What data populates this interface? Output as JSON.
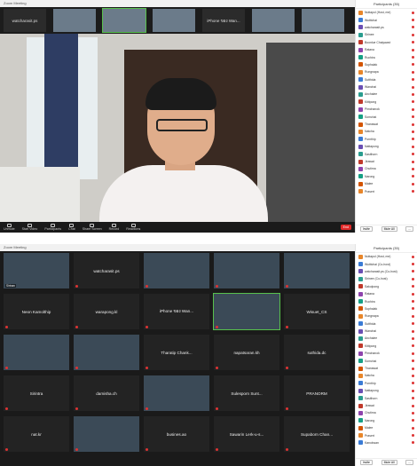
{
  "window1": {
    "title": "Zoom Meeting",
    "thumbs": [
      "watcharasit.ps",
      "",
      "",
      "",
      "iPhone ของ Wan...",
      "",
      ""
    ],
    "toolbar": [
      "Unmute",
      "Start Video",
      "Participants",
      "Chat",
      "Share Screen",
      "Record",
      "Reactions"
    ],
    "end_label": "End",
    "panel_title": "Participants (35)",
    "participants": [
      "Nuttapol (Host, me)",
      "Wuttichai",
      "watcharasit.ps",
      "Sirinee",
      "Boonlue Chaiyawut",
      "Ratana",
      "Ruchira",
      "Suphalak",
      "Rungnapa",
      "Sutthida",
      "Wanchai",
      "Anchalee",
      "Kittipong",
      "Pimchanok",
      "Somchai",
      "Thanawat",
      "Natcha",
      "Pornthip",
      "Nattapong",
      "Sasithorn",
      "Jirawat",
      "Chutima",
      "Narong",
      "Malee",
      "Prasert"
    ],
    "footer": [
      "Invite",
      "Mute All",
      "..."
    ]
  },
  "window2": {
    "title": "Zoom Meeting",
    "cells": [
      {
        "label": "",
        "name": "Sirinan",
        "video": true
      },
      {
        "label": "watcharasit.ps",
        "name": "",
        "video": false
      },
      {
        "label": "",
        "name": "",
        "video": true
      },
      {
        "label": "",
        "name": "",
        "video": true
      },
      {
        "label": "",
        "name": "",
        "video": true
      },
      {
        "label": "Neon Kamolthip",
        "name": "",
        "video": false
      },
      {
        "label": "warapong.kl",
        "name": "",
        "video": false
      },
      {
        "label": "iPhone ของ Wan...",
        "name": "",
        "video": false
      },
      {
        "label": "",
        "name": "",
        "video": true
      },
      {
        "label": "Wisuet_CS",
        "name": "",
        "video": false
      },
      {
        "label": "",
        "name": "",
        "video": true
      },
      {
        "label": "",
        "name": "",
        "video": true
      },
      {
        "label": "Tharatip Chank...",
        "name": "",
        "video": false
      },
      {
        "label": "napatsaran.kh",
        "name": "",
        "video": false
      },
      {
        "label": "suthida.dc",
        "name": "",
        "video": false
      },
      {
        "label": "Sirintra",
        "name": "",
        "video": false
      },
      {
        "label": "damisha.ch",
        "name": "",
        "video": false
      },
      {
        "label": "",
        "name": "",
        "video": true
      },
      {
        "label": "Sulesporn Sunt...",
        "name": "",
        "video": false
      },
      {
        "label": "PRANORM",
        "name": "",
        "video": false
      },
      {
        "label": "nat.kr",
        "name": "",
        "video": false
      },
      {
        "label": "",
        "name": "",
        "video": true
      },
      {
        "label": "busines.ao",
        "name": "",
        "video": false
      },
      {
        "label": "Sawarin Lerk-u-s...",
        "name": "",
        "video": false
      },
      {
        "label": "Supaborn Chan...",
        "name": "",
        "video": false
      }
    ],
    "panel_title": "Participants (35)",
    "participants": [
      "Nuttapol (Host, me)",
      "Wuttichai (Co-host)",
      "watcharasit.ps (Co-host)",
      "Sirinee (Co-host)",
      "Sakulpong",
      "Ratana",
      "Ruchira",
      "Suphalak",
      "Rungnapa",
      "Sutthida",
      "Wanchai",
      "Anchalee",
      "Kittipong",
      "Pimchanok",
      "Somchai",
      "Thanawat",
      "Natcha",
      "Pornthip",
      "Nattapong",
      "Sasithorn",
      "Jirawat",
      "Chutima",
      "Narong",
      "Malee",
      "Prasert",
      "Kanokwan"
    ],
    "footer": [
      "Invite",
      "Mute All",
      "..."
    ]
  },
  "colors": {
    "dark_bg": "#1a1a1a",
    "tile_bg": "#232323",
    "active_speaker": "#58c04c",
    "end_button": "#e02828",
    "muted": "#dd3333"
  }
}
